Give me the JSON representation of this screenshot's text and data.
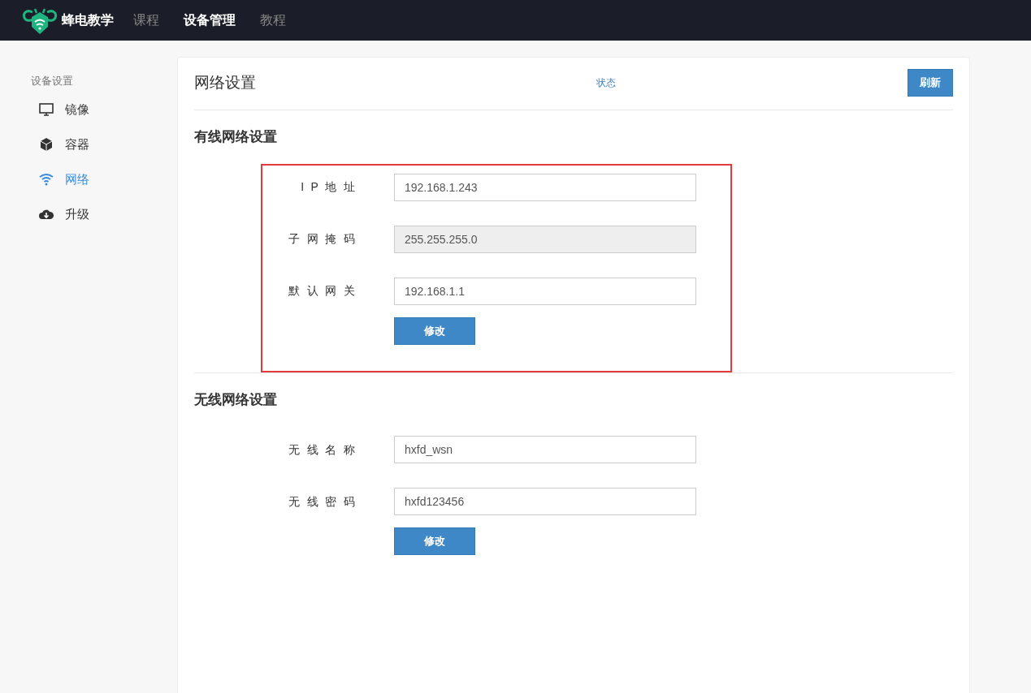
{
  "navbar": {
    "brand": "蜂电教学",
    "links": [
      {
        "label": "课程",
        "selected": false
      },
      {
        "label": "设备管理",
        "selected": true
      },
      {
        "label": "教程",
        "selected": false
      }
    ]
  },
  "sidebar": {
    "heading": "设备设置",
    "items": [
      {
        "label": "镜像",
        "kind": "monitor",
        "selected": false
      },
      {
        "label": "容器",
        "kind": "box",
        "selected": false
      },
      {
        "label": "网络",
        "kind": "wifi",
        "selected": true
      },
      {
        "label": "升级",
        "kind": "cloud",
        "selected": false
      }
    ]
  },
  "panel": {
    "title": "网络设置",
    "status_link": "状态",
    "refresh_button": "刷新",
    "sections": [
      {
        "title": "有线网络设置",
        "highlighted": true,
        "fields": [
          {
            "label": "IP地址",
            "value": "192.168.1.243",
            "disabled": false
          },
          {
            "label": "子网掩码",
            "value": "255.255.255.0",
            "disabled": true
          },
          {
            "label": "默认网关",
            "value": "192.168.1.1",
            "disabled": false
          }
        ],
        "button": "修改"
      },
      {
        "title": "无线网络设置",
        "highlighted": false,
        "fields": [
          {
            "label": "无线名称",
            "value": "hxfd_wsn",
            "disabled": false
          },
          {
            "label": "无线密码",
            "value": "hxfd123456",
            "disabled": false
          }
        ],
        "button": "修改"
      }
    ]
  }
}
